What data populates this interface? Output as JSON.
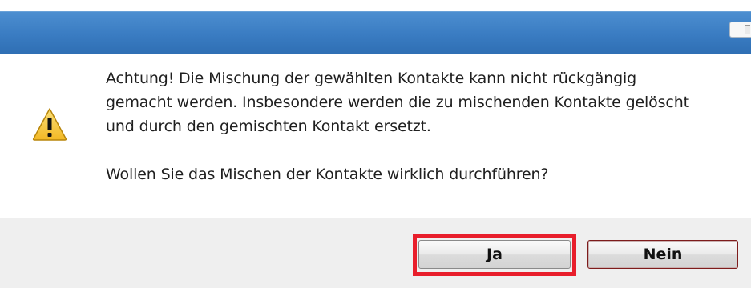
{
  "message": {
    "line1": "Achtung! Die Mischung der gewählten Kontakte kann nicht rückgängig",
    "line2": "gemacht werden. Insbesondere werden die zu mischenden Kontakte gelöscht",
    "line3": "und durch den gemischten Kontakt ersetzt.",
    "question": "Wollen Sie das Mischen der Kontakte wirklich durchführen?"
  },
  "buttons": {
    "yes": "Ja",
    "no": "Nein"
  },
  "icon": "warning-icon",
  "colors": {
    "titlebar": "#3a7cc2",
    "highlight": "#e81e2b",
    "warning_fill": "#f6c634"
  }
}
